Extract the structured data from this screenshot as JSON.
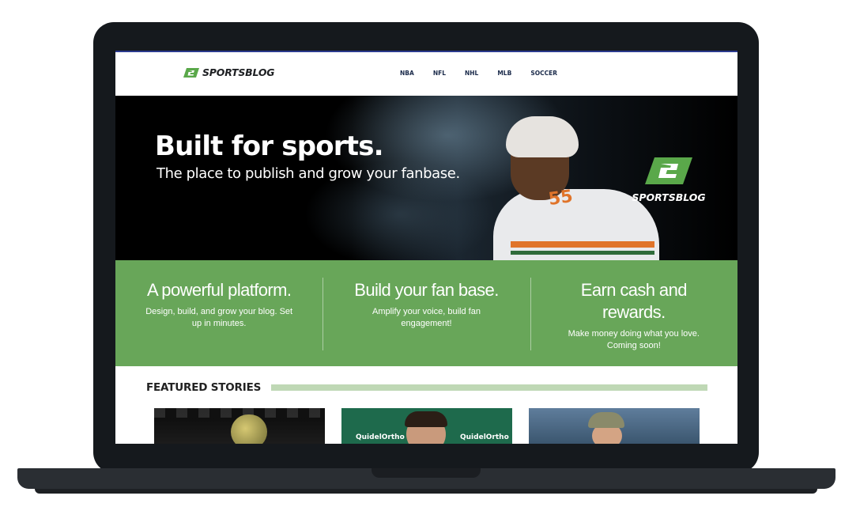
{
  "site": {
    "brand": "SPORTSBLOG",
    "nav": [
      "NBA",
      "NFL",
      "NHL",
      "MLB",
      "SOCCER"
    ]
  },
  "hero": {
    "title": "Built for sports.",
    "subtitle": "The place to publish and grow your fanbase.",
    "logo_text": "SPORTSBLOG",
    "jersey_number": "55"
  },
  "features": [
    {
      "title": "A powerful platform.",
      "desc": "Design, build, and grow your blog. Set up in minutes."
    },
    {
      "title": "Build your fan base.",
      "desc": "Amplify your voice, build fan engagement!"
    },
    {
      "title": "Earn cash and rewards.",
      "desc": "Make money doing what you love. Coming soon!"
    }
  ],
  "featured": {
    "heading": "FEATURED STORIES",
    "sponsor_text": "QuidelOrtho"
  },
  "colors": {
    "brand_green": "#68a659",
    "bar_green": "#bfd8b5",
    "laptop_frame": "#15191d"
  }
}
